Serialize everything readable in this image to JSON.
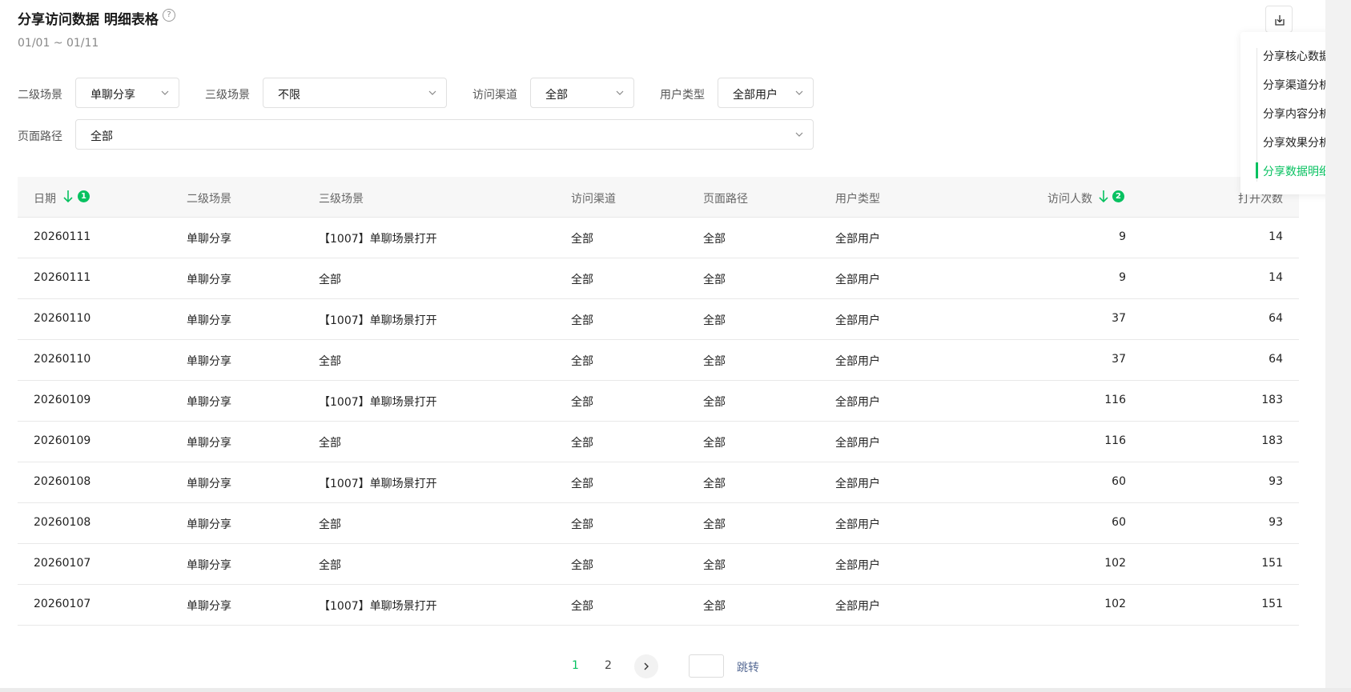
{
  "header": {
    "title": "分享访问数据 明细表格",
    "help_icon": "?",
    "date_range": "01/01 ~ 01/11"
  },
  "filters": {
    "level2": {
      "label": "二级场景",
      "value": "单聊分享"
    },
    "level3": {
      "label": "三级场景",
      "value": "不限"
    },
    "channel": {
      "label": "访问渠道",
      "value": "全部"
    },
    "user_type": {
      "label": "用户类型",
      "value": "全部用户"
    },
    "page_path": {
      "label": "页面路径",
      "value": "全部"
    }
  },
  "toc": {
    "items": [
      "分享核心数据",
      "分享渠道分析",
      "分享内容分析",
      "分享效果分析",
      "分享数据明细"
    ],
    "active_index": 4
  },
  "table": {
    "columns": [
      "日期",
      "二级场景",
      "三级场景",
      "访问渠道",
      "页面路径",
      "用户类型",
      "访问人数",
      "打开次数"
    ],
    "sort_badges": [
      "1",
      "2"
    ],
    "rows": [
      [
        "20260111",
        "单聊分享",
        "【1007】单聊场景打开",
        "全部",
        "全部",
        "全部用户",
        "9",
        "14"
      ],
      [
        "20260111",
        "单聊分享",
        "全部",
        "全部",
        "全部",
        "全部用户",
        "9",
        "14"
      ],
      [
        "20260110",
        "单聊分享",
        "【1007】单聊场景打开",
        "全部",
        "全部",
        "全部用户",
        "37",
        "64"
      ],
      [
        "20260110",
        "单聊分享",
        "全部",
        "全部",
        "全部",
        "全部用户",
        "37",
        "64"
      ],
      [
        "20260109",
        "单聊分享",
        "【1007】单聊场景打开",
        "全部",
        "全部",
        "全部用户",
        "116",
        "183"
      ],
      [
        "20260109",
        "单聊分享",
        "全部",
        "全部",
        "全部",
        "全部用户",
        "116",
        "183"
      ],
      [
        "20260108",
        "单聊分享",
        "【1007】单聊场景打开",
        "全部",
        "全部",
        "全部用户",
        "60",
        "93"
      ],
      [
        "20260108",
        "单聊分享",
        "全部",
        "全部",
        "全部",
        "全部用户",
        "60",
        "93"
      ],
      [
        "20260107",
        "单聊分享",
        "全部",
        "全部",
        "全部",
        "全部用户",
        "102",
        "151"
      ],
      [
        "20260107",
        "单聊分享",
        "【1007】单聊场景打开",
        "全部",
        "全部",
        "全部用户",
        "102",
        "151"
      ]
    ]
  },
  "pagination": {
    "pages": [
      "1",
      "2"
    ],
    "current": "1",
    "jump_label": "跳转"
  },
  "colors": {
    "accent": "#07c160",
    "link": "#576b95"
  }
}
